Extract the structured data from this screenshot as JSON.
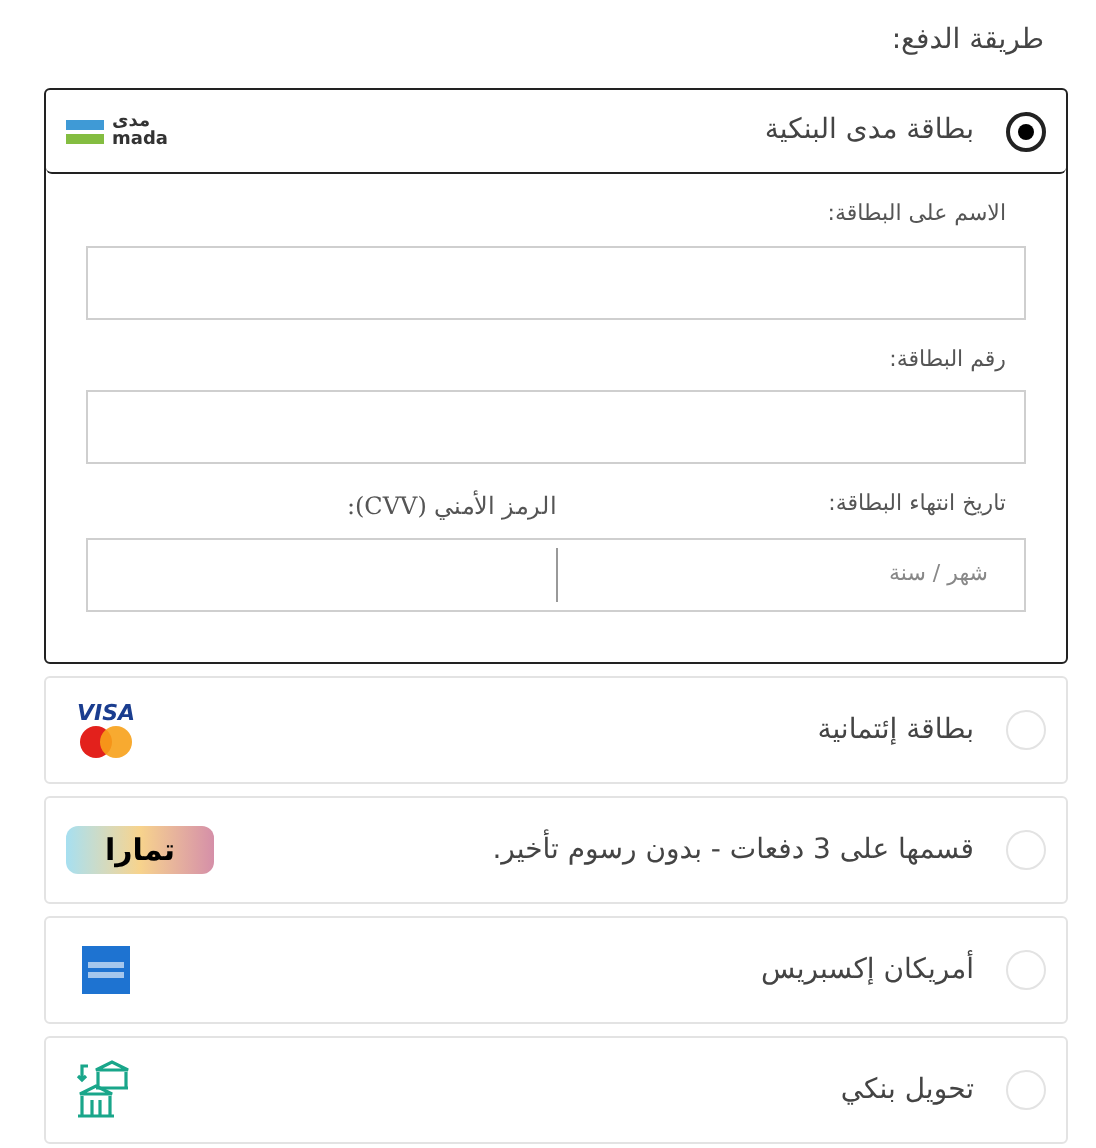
{
  "heading": "طريقة الدفع:",
  "methods": [
    {
      "label": "بطاقة مدى البنكية",
      "selected": true,
      "kind": "mada",
      "logo_text": [
        "مدى",
        "mada"
      ],
      "expanded": true
    },
    {
      "label": "بطاقة إئتمانية",
      "selected": false,
      "kind": "visa_mastercard",
      "logo_text": [
        "VISA"
      ]
    },
    {
      "label": "قسمها على 3 دفعات - بدون رسوم تأخير.",
      "selected": false,
      "kind": "tamara",
      "logo_text": [
        "تمارا"
      ]
    },
    {
      "label": "أمريكان إكسبريس",
      "selected": false,
      "kind": "amex"
    },
    {
      "label": "تحويل بنكي",
      "selected": false,
      "kind": "bank"
    }
  ],
  "card_form": {
    "name_label": "الاسم على البطاقة:",
    "number_label": "رقم البطاقة:",
    "expiry_label": "تاريخ انتهاء البطاقة:",
    "expiry_placeholder": "شهر / سنة",
    "cvv_label": "الرمز الأمني (CVV):"
  }
}
